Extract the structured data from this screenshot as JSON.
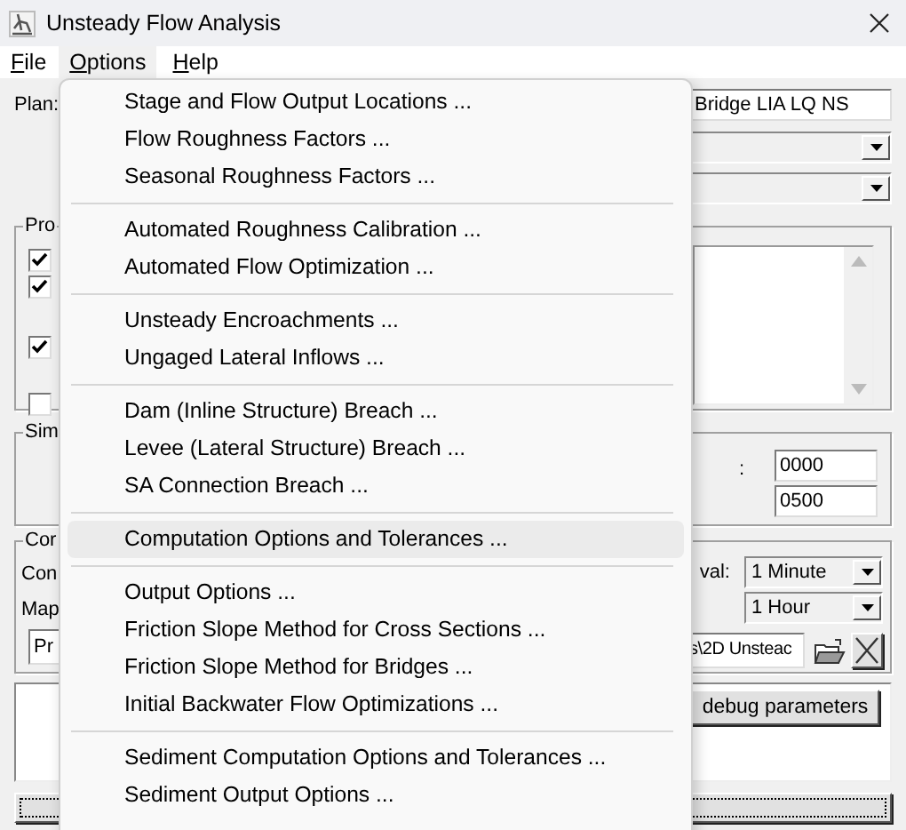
{
  "window": {
    "title": "Unsteady Flow Analysis"
  },
  "menu_bar": [
    {
      "label": "File",
      "selected": false
    },
    {
      "label": "Options",
      "selected": true
    },
    {
      "label": "Help",
      "selected": false
    }
  ],
  "plan": {
    "label": "Plan:",
    "value": "Bridge LIA LQ NS"
  },
  "programs_group": {
    "label": "Pro",
    "checkboxes": [
      {
        "checked": true
      },
      {
        "checked": true
      },
      {
        "checked": true
      },
      {
        "checked": false
      }
    ]
  },
  "simulation_group": {
    "label": "Sim",
    "colon": ":",
    "fields": [
      "0000",
      "0500"
    ]
  },
  "computation_group": {
    "label": "Cor",
    "row_label": "Con",
    "map_label": "Map",
    "interval_label": "val:",
    "intervals": [
      "1 Minute",
      "1 Hour"
    ],
    "path_start": "Pr",
    "path_end": "s\\2D Unsteac"
  },
  "debug_button": "debug parameters",
  "options_menu": {
    "groups": [
      {
        "items": [
          {
            "label": "Stage and Flow Output Locations ...",
            "selected": false
          },
          {
            "label": "Flow Roughness Factors ...",
            "selected": false
          },
          {
            "label": "Seasonal Roughness Factors ...",
            "selected": false
          }
        ]
      },
      {
        "items": [
          {
            "label": "Automated Roughness Calibration ...",
            "selected": false
          },
          {
            "label": "Automated Flow Optimization ...",
            "selected": false
          }
        ]
      },
      {
        "items": [
          {
            "label": "Unsteady Encroachments ...",
            "selected": false
          },
          {
            "label": "Ungaged Lateral Inflows ...",
            "selected": false
          }
        ]
      },
      {
        "items": [
          {
            "label": "Dam (Inline Structure) Breach ...",
            "selected": false
          },
          {
            "label": "Levee (Lateral Structure) Breach ...",
            "selected": false
          },
          {
            "label": "SA Connection Breach ...",
            "selected": false
          }
        ]
      },
      {
        "items": [
          {
            "label": "Computation Options and Tolerances ...",
            "selected": true
          }
        ]
      },
      {
        "items": [
          {
            "label": "Output Options ...",
            "selected": false
          },
          {
            "label": "Friction Slope Method for Cross Sections ...",
            "selected": false
          },
          {
            "label": "Friction Slope Method for Bridges ...",
            "selected": false
          },
          {
            "label": "Initial Backwater Flow Optimizations ...",
            "selected": false
          }
        ]
      },
      {
        "items": [
          {
            "label": "Sediment Computation Options and Tolerances ...",
            "selected": false
          },
          {
            "label": "Sediment Output Options ...",
            "selected": false
          }
        ]
      }
    ]
  }
}
